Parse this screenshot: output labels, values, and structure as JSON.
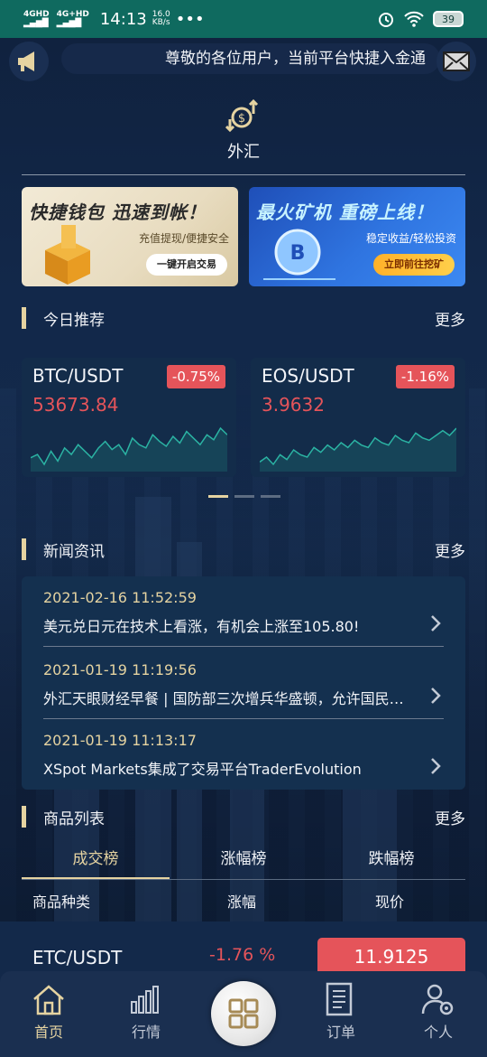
{
  "status_bar": {
    "signal_1": "4GHD",
    "signal_2": "4G+HD",
    "time": "14:13",
    "speed_value": "16.0",
    "speed_unit": "KB/s",
    "more": "•••",
    "battery": "39"
  },
  "notice": {
    "text": "尊敬的各位用户，当前平台快捷入金通"
  },
  "forex": {
    "label": "外汇"
  },
  "banners": [
    {
      "title": "快捷钱包  迅速到帐！",
      "subtitle": "充值提现/便捷安全",
      "button": "一键开启交易"
    },
    {
      "title": "最火矿机  重磅上线！",
      "subtitle": "稳定收益/轻松投资",
      "button": "立即前往挖矿"
    }
  ],
  "today": {
    "title": "今日推荐",
    "more": "更多"
  },
  "tickers": [
    {
      "pair": "BTC/USDT",
      "change": "-0.75%",
      "price": "53673.84",
      "spark": [
        22,
        24,
        18,
        26,
        20,
        28,
        24,
        30,
        26,
        22,
        28,
        32,
        27,
        30,
        24,
        34,
        30,
        28,
        36,
        32,
        29,
        35,
        31,
        38,
        34,
        30,
        36,
        33,
        40,
        36
      ]
    },
    {
      "pair": "EOS/USDT",
      "change": "-1.16%",
      "price": "3.9632",
      "spark": [
        14,
        18,
        12,
        20,
        16,
        24,
        20,
        18,
        26,
        22,
        28,
        24,
        30,
        26,
        32,
        28,
        26,
        34,
        30,
        28,
        36,
        32,
        30,
        38,
        34,
        32,
        36,
        40,
        36,
        42
      ]
    }
  ],
  "news_section": {
    "title": "新闻资讯",
    "more": "更多"
  },
  "news": [
    {
      "date": "2021-02-16 11:52:59",
      "title": "美元兑日元在技术上看涨，有机会上涨至105.80!"
    },
    {
      "date": "2021-01-19 11:19:56",
      "title": "外汇天眼财经早餐 | 国防部三次增兵华盛顿，允许国民警卫队携带武器"
    },
    {
      "date": "2021-01-19 11:13:17",
      "title": "XSpot Markets集成了交易平台TraderEvolution"
    }
  ],
  "products": {
    "title": "商品列表",
    "more": "更多"
  },
  "market_tabs": [
    "成交榜",
    "涨幅榜",
    "跌幅榜"
  ],
  "columns": {
    "name": "商品种类",
    "change": "涨幅",
    "price": "现价"
  },
  "rows": [
    {
      "pair": "ETC/USDT",
      "change": "-1.76 %",
      "price": "11.9125"
    }
  ],
  "nav": [
    {
      "label": "首页",
      "icon": "home-icon"
    },
    {
      "label": "行情",
      "icon": "market-bars-icon"
    },
    {
      "label": "订单",
      "icon": "order-icon"
    },
    {
      "label": "个人",
      "icon": "user-settings-icon"
    }
  ],
  "colors": {
    "accent": "#e5d3a1",
    "down": "#e5545a",
    "status_bar": "#0f6a5f"
  }
}
